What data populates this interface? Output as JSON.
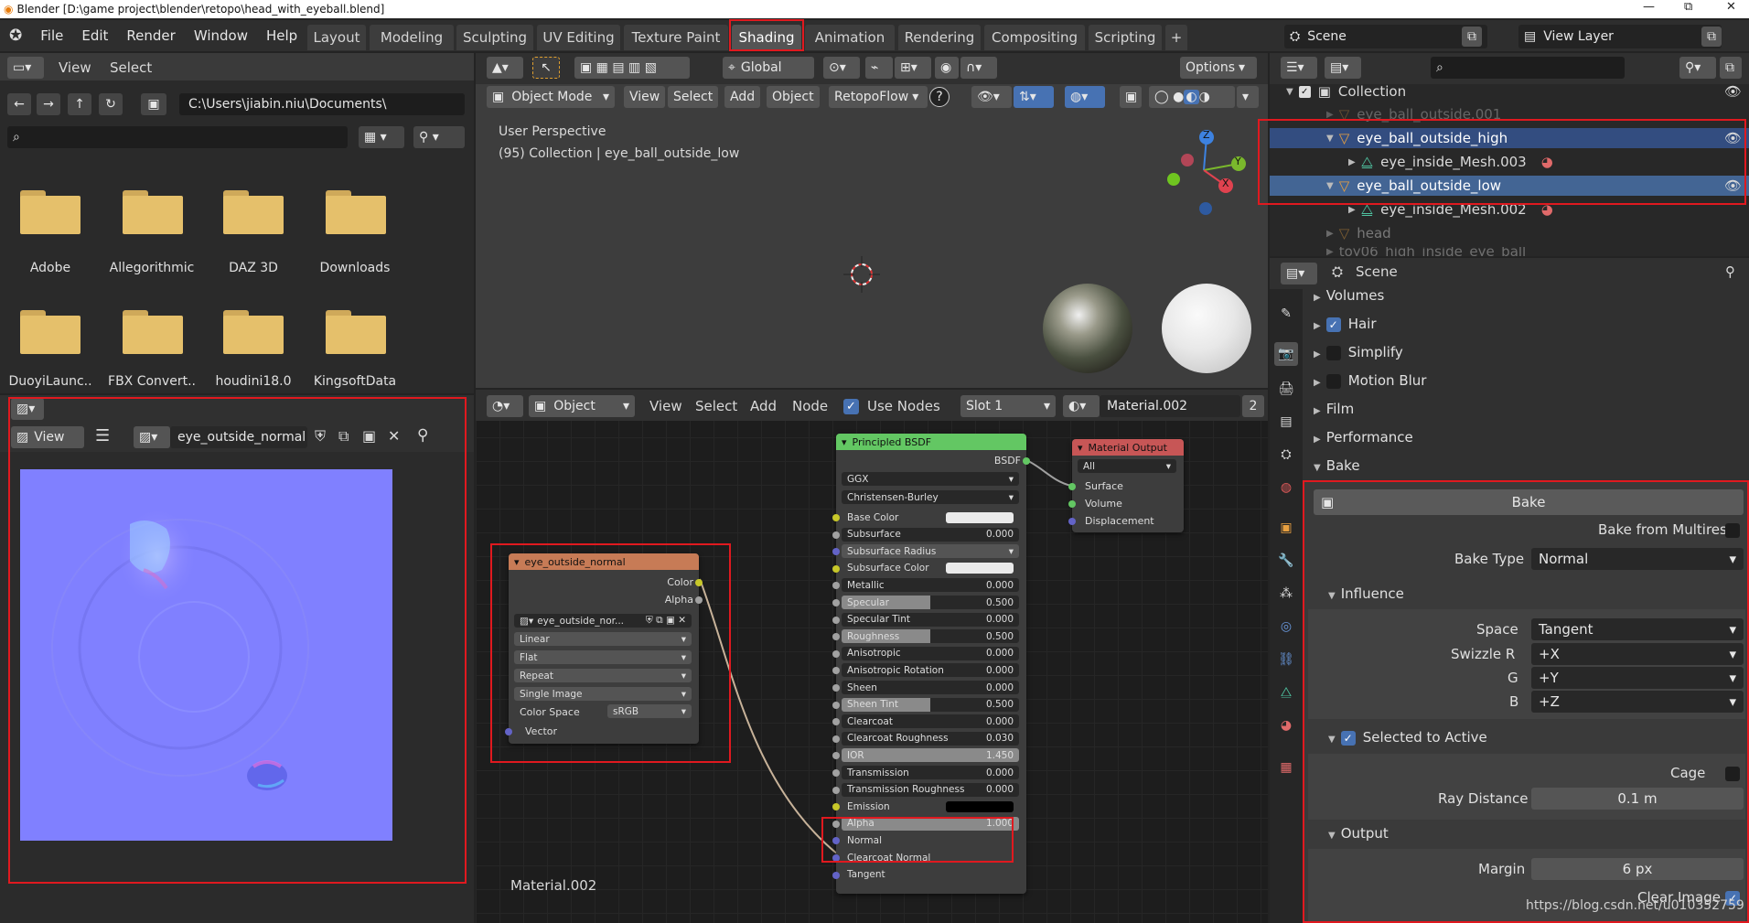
{
  "window": {
    "title": "Blender [D:\\game project\\blender\\retopo\\head_with_eyeball.blend]",
    "controls": [
      "—",
      "⧉",
      "✕"
    ]
  },
  "menu": [
    "File",
    "Edit",
    "Render",
    "Window",
    "Help"
  ],
  "workspaces": [
    "Layout",
    "Modeling",
    "Sculpting",
    "UV Editing",
    "Texture Paint",
    "Shading",
    "Animation",
    "Rendering",
    "Compositing",
    "Scripting"
  ],
  "active_workspace": "Shading",
  "scene_name": "Scene",
  "view_layer": "View Layer",
  "file_browser": {
    "menus": [
      "View",
      "Select"
    ],
    "path": "C:\\Users\\jiabin.niu\\Documents\\",
    "folders": [
      "Adobe",
      "Allegorithmic",
      "DAZ 3D",
      "Downloads",
      "DuoyiLaunc..",
      "FBX Convert..",
      "houdini18.0",
      "KingsoftData"
    ]
  },
  "image_editor": {
    "view_label": "View",
    "image_name": "eye_outside_normal"
  },
  "viewport": {
    "transform": "Global",
    "options": "Options",
    "mode": "Object Mode",
    "menus": [
      "View",
      "Select",
      "Add",
      "Object"
    ],
    "addon": "RetopoFlow",
    "perspective": "User Perspective",
    "collection_info": "(95) Collection | eye_ball_outside_low",
    "gizmo": {
      "z": "Z",
      "y": "Y",
      "x": "X"
    }
  },
  "node_editor": {
    "editor_type": "Object",
    "menus": [
      "View",
      "Select",
      "Add",
      "Node"
    ],
    "use_nodes": "Use Nodes",
    "slot": "Slot 1",
    "material": "Material.002",
    "material_users": "2",
    "material_label": "Material.002",
    "image_node": {
      "title": "eye_outside_normal",
      "outputs": [
        "Color",
        "Alpha"
      ],
      "image": "eye_outside_nor...",
      "interpolation": "Linear",
      "projection": "Flat",
      "extension": "Repeat",
      "source": "Single Image",
      "color_space_label": "Color Space",
      "color_space": "sRGB",
      "input": "Vector"
    },
    "bsdf_node": {
      "title": "Principled BSDF",
      "output": "BSDF",
      "distribution": "GGX",
      "subsurface_method": "Christensen-Burley",
      "inputs": [
        {
          "label": "Base Color",
          "value": "",
          "kind": "color"
        },
        {
          "label": "Subsurface",
          "value": "0.000",
          "kind": "dark"
        },
        {
          "label": "Subsurface Radius",
          "value": "",
          "kind": "dropdown"
        },
        {
          "label": "Subsurface Color",
          "value": "",
          "kind": "color"
        },
        {
          "label": "Metallic",
          "value": "0.000",
          "kind": "dark"
        },
        {
          "label": "Specular",
          "value": "0.500",
          "kind": "half"
        },
        {
          "label": "Specular Tint",
          "value": "0.000",
          "kind": "dark"
        },
        {
          "label": "Roughness",
          "value": "0.500",
          "kind": "half"
        },
        {
          "label": "Anisotropic",
          "value": "0.000",
          "kind": "dark"
        },
        {
          "label": "Anisotropic Rotation",
          "value": "0.000",
          "kind": "dark"
        },
        {
          "label": "Sheen",
          "value": "0.000",
          "kind": "dark"
        },
        {
          "label": "Sheen Tint",
          "value": "0.500",
          "kind": "half"
        },
        {
          "label": "Clearcoat",
          "value": "0.000",
          "kind": "dark"
        },
        {
          "label": "Clearcoat Roughness",
          "value": "0.030",
          "kind": "dark"
        },
        {
          "label": "IOR",
          "value": "1.450",
          "kind": "full"
        },
        {
          "label": "Transmission",
          "value": "0.000",
          "kind": "dark"
        },
        {
          "label": "Transmission Roughness",
          "value": "0.000",
          "kind": "dark"
        },
        {
          "label": "Emission",
          "value": "",
          "kind": "black"
        },
        {
          "label": "Alpha",
          "value": "1.000",
          "kind": "full"
        },
        {
          "label": "Normal",
          "value": "",
          "kind": "socket"
        },
        {
          "label": "Clearcoat Normal",
          "value": "",
          "kind": "socket"
        },
        {
          "label": "Tangent",
          "value": "",
          "kind": "socket"
        }
      ]
    },
    "output_node": {
      "title": "Material Output",
      "target": "All",
      "inputs": [
        "Surface",
        "Volume",
        "Displacement"
      ]
    }
  },
  "outliner": {
    "items": [
      {
        "name": "Collection"
      },
      {
        "name": "eye_ball_outside.001"
      },
      {
        "name": "eye_ball_outside_high"
      },
      {
        "name": "eye_inside_Mesh.003"
      },
      {
        "name": "eye_ball_outside_low"
      },
      {
        "name": "eye_inside_Mesh.002"
      },
      {
        "name": "head"
      },
      {
        "name": "toy06_high_inside_eye_ball"
      }
    ]
  },
  "properties": {
    "context": "Scene",
    "sections": [
      "Volumes",
      "Hair",
      "Simplify",
      "Motion Blur",
      "Film",
      "Performance",
      "Bake"
    ],
    "bake_button": "Bake",
    "bake_from_multires": "Bake from Multires",
    "bake_type_label": "Bake Type",
    "bake_type": "Normal",
    "influence": "Influence",
    "space_label": "Space",
    "space": "Tangent",
    "swizzle_r_label": "Swizzle R",
    "swizzle_r": "+X",
    "g_label": "G",
    "swizzle_g": "+Y",
    "b_label": "B",
    "swizzle_b": "+Z",
    "selected_to_active": "Selected to Active",
    "cage": "Cage",
    "ray_distance_label": "Ray Distance",
    "ray_distance": "0.1 m",
    "output": "Output",
    "margin_label": "Margin",
    "margin": "6 px",
    "clear_image": "Clear Image"
  },
  "watermark": "https://blog.csdn.net/u010352759",
  "colors": {
    "annotation": "#e0191f",
    "accent": "#4772b3",
    "folder": "#e5c06b",
    "normal_map": "#7f7fff"
  }
}
